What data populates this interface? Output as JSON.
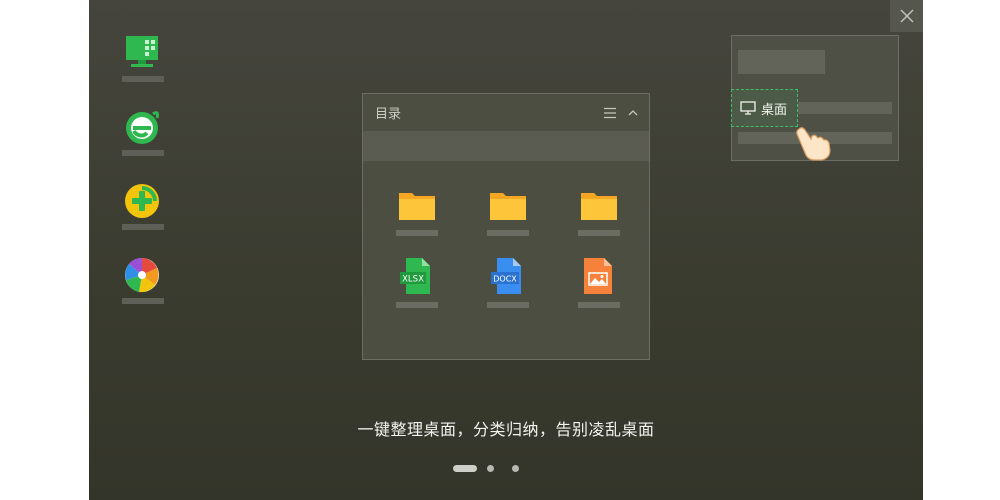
{
  "window": {
    "close_icon": "close-icon"
  },
  "left_apps": [
    {
      "name": "monitor-app",
      "icon": "monitor-grid-icon",
      "color": "#2fb84f"
    },
    {
      "name": "browser-app",
      "icon": "green-e-browser-icon",
      "color": "#2fb84f"
    },
    {
      "name": "security-app",
      "icon": "plus-shield-icon",
      "color": "#f2c40c"
    },
    {
      "name": "photo-app",
      "icon": "pinwheel-icon",
      "color": "#e64a3c"
    }
  ],
  "directory": {
    "title": "目录",
    "menu_icon": "menu-icon",
    "collapse_icon": "chevron-up-icon",
    "files": [
      {
        "type": "folder",
        "icon": "folder-icon"
      },
      {
        "type": "folder",
        "icon": "folder-icon"
      },
      {
        "type": "folder",
        "icon": "folder-icon"
      },
      {
        "type": "xlsx",
        "icon": "xlsx-file-icon",
        "badge": "XLSX"
      },
      {
        "type": "docx",
        "icon": "docx-file-icon",
        "badge": "DOCX"
      },
      {
        "type": "image",
        "icon": "image-file-icon"
      }
    ]
  },
  "desktop_chip": {
    "label": "桌面",
    "icon": "monitor-icon"
  },
  "tagline": "一键整理桌面，分类归纳，告别凌乱桌面",
  "pager": {
    "count": 3,
    "active": 0
  }
}
